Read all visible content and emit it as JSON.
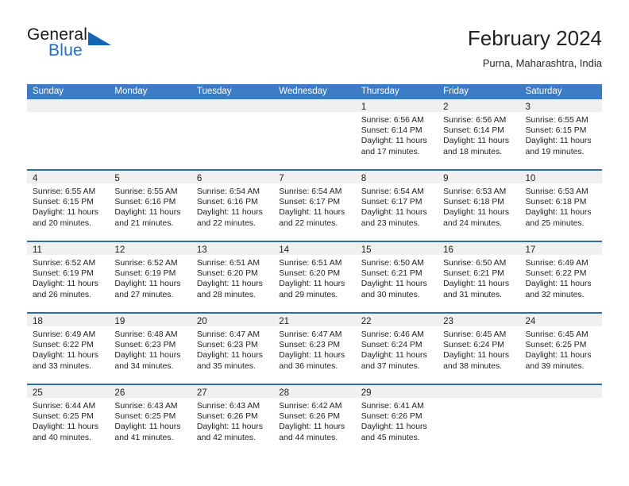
{
  "brand": {
    "name_top": "General",
    "name_bottom": "Blue",
    "accent_color": "#1166b4"
  },
  "header": {
    "title": "February 2024",
    "subtitle": "Purna, Maharashtra, India"
  },
  "theme": {
    "header_band": "#3b7cc4",
    "row_divider": "#2e6cad",
    "day_band": "#f0f0f0"
  },
  "weekdays": [
    "Sunday",
    "Monday",
    "Tuesday",
    "Wednesday",
    "Thursday",
    "Friday",
    "Saturday"
  ],
  "weeks": [
    [
      {
        "day": "",
        "sunrise": "",
        "sunset": "",
        "daylight1": "",
        "daylight2": ""
      },
      {
        "day": "",
        "sunrise": "",
        "sunset": "",
        "daylight1": "",
        "daylight2": ""
      },
      {
        "day": "",
        "sunrise": "",
        "sunset": "",
        "daylight1": "",
        "daylight2": ""
      },
      {
        "day": "",
        "sunrise": "",
        "sunset": "",
        "daylight1": "",
        "daylight2": ""
      },
      {
        "day": "1",
        "sunrise": "Sunrise: 6:56 AM",
        "sunset": "Sunset: 6:14 PM",
        "daylight1": "Daylight: 11 hours",
        "daylight2": "and 17 minutes."
      },
      {
        "day": "2",
        "sunrise": "Sunrise: 6:56 AM",
        "sunset": "Sunset: 6:14 PM",
        "daylight1": "Daylight: 11 hours",
        "daylight2": "and 18 minutes."
      },
      {
        "day": "3",
        "sunrise": "Sunrise: 6:55 AM",
        "sunset": "Sunset: 6:15 PM",
        "daylight1": "Daylight: 11 hours",
        "daylight2": "and 19 minutes."
      }
    ],
    [
      {
        "day": "4",
        "sunrise": "Sunrise: 6:55 AM",
        "sunset": "Sunset: 6:15 PM",
        "daylight1": "Daylight: 11 hours",
        "daylight2": "and 20 minutes."
      },
      {
        "day": "5",
        "sunrise": "Sunrise: 6:55 AM",
        "sunset": "Sunset: 6:16 PM",
        "daylight1": "Daylight: 11 hours",
        "daylight2": "and 21 minutes."
      },
      {
        "day": "6",
        "sunrise": "Sunrise: 6:54 AM",
        "sunset": "Sunset: 6:16 PM",
        "daylight1": "Daylight: 11 hours",
        "daylight2": "and 22 minutes."
      },
      {
        "day": "7",
        "sunrise": "Sunrise: 6:54 AM",
        "sunset": "Sunset: 6:17 PM",
        "daylight1": "Daylight: 11 hours",
        "daylight2": "and 22 minutes."
      },
      {
        "day": "8",
        "sunrise": "Sunrise: 6:54 AM",
        "sunset": "Sunset: 6:17 PM",
        "daylight1": "Daylight: 11 hours",
        "daylight2": "and 23 minutes."
      },
      {
        "day": "9",
        "sunrise": "Sunrise: 6:53 AM",
        "sunset": "Sunset: 6:18 PM",
        "daylight1": "Daylight: 11 hours",
        "daylight2": "and 24 minutes."
      },
      {
        "day": "10",
        "sunrise": "Sunrise: 6:53 AM",
        "sunset": "Sunset: 6:18 PM",
        "daylight1": "Daylight: 11 hours",
        "daylight2": "and 25 minutes."
      }
    ],
    [
      {
        "day": "11",
        "sunrise": "Sunrise: 6:52 AM",
        "sunset": "Sunset: 6:19 PM",
        "daylight1": "Daylight: 11 hours",
        "daylight2": "and 26 minutes."
      },
      {
        "day": "12",
        "sunrise": "Sunrise: 6:52 AM",
        "sunset": "Sunset: 6:19 PM",
        "daylight1": "Daylight: 11 hours",
        "daylight2": "and 27 minutes."
      },
      {
        "day": "13",
        "sunrise": "Sunrise: 6:51 AM",
        "sunset": "Sunset: 6:20 PM",
        "daylight1": "Daylight: 11 hours",
        "daylight2": "and 28 minutes."
      },
      {
        "day": "14",
        "sunrise": "Sunrise: 6:51 AM",
        "sunset": "Sunset: 6:20 PM",
        "daylight1": "Daylight: 11 hours",
        "daylight2": "and 29 minutes."
      },
      {
        "day": "15",
        "sunrise": "Sunrise: 6:50 AM",
        "sunset": "Sunset: 6:21 PM",
        "daylight1": "Daylight: 11 hours",
        "daylight2": "and 30 minutes."
      },
      {
        "day": "16",
        "sunrise": "Sunrise: 6:50 AM",
        "sunset": "Sunset: 6:21 PM",
        "daylight1": "Daylight: 11 hours",
        "daylight2": "and 31 minutes."
      },
      {
        "day": "17",
        "sunrise": "Sunrise: 6:49 AM",
        "sunset": "Sunset: 6:22 PM",
        "daylight1": "Daylight: 11 hours",
        "daylight2": "and 32 minutes."
      }
    ],
    [
      {
        "day": "18",
        "sunrise": "Sunrise: 6:49 AM",
        "sunset": "Sunset: 6:22 PM",
        "daylight1": "Daylight: 11 hours",
        "daylight2": "and 33 minutes."
      },
      {
        "day": "19",
        "sunrise": "Sunrise: 6:48 AM",
        "sunset": "Sunset: 6:23 PM",
        "daylight1": "Daylight: 11 hours",
        "daylight2": "and 34 minutes."
      },
      {
        "day": "20",
        "sunrise": "Sunrise: 6:47 AM",
        "sunset": "Sunset: 6:23 PM",
        "daylight1": "Daylight: 11 hours",
        "daylight2": "and 35 minutes."
      },
      {
        "day": "21",
        "sunrise": "Sunrise: 6:47 AM",
        "sunset": "Sunset: 6:23 PM",
        "daylight1": "Daylight: 11 hours",
        "daylight2": "and 36 minutes."
      },
      {
        "day": "22",
        "sunrise": "Sunrise: 6:46 AM",
        "sunset": "Sunset: 6:24 PM",
        "daylight1": "Daylight: 11 hours",
        "daylight2": "and 37 minutes."
      },
      {
        "day": "23",
        "sunrise": "Sunrise: 6:45 AM",
        "sunset": "Sunset: 6:24 PM",
        "daylight1": "Daylight: 11 hours",
        "daylight2": "and 38 minutes."
      },
      {
        "day": "24",
        "sunrise": "Sunrise: 6:45 AM",
        "sunset": "Sunset: 6:25 PM",
        "daylight1": "Daylight: 11 hours",
        "daylight2": "and 39 minutes."
      }
    ],
    [
      {
        "day": "25",
        "sunrise": "Sunrise: 6:44 AM",
        "sunset": "Sunset: 6:25 PM",
        "daylight1": "Daylight: 11 hours",
        "daylight2": "and 40 minutes."
      },
      {
        "day": "26",
        "sunrise": "Sunrise: 6:43 AM",
        "sunset": "Sunset: 6:25 PM",
        "daylight1": "Daylight: 11 hours",
        "daylight2": "and 41 minutes."
      },
      {
        "day": "27",
        "sunrise": "Sunrise: 6:43 AM",
        "sunset": "Sunset: 6:26 PM",
        "daylight1": "Daylight: 11 hours",
        "daylight2": "and 42 minutes."
      },
      {
        "day": "28",
        "sunrise": "Sunrise: 6:42 AM",
        "sunset": "Sunset: 6:26 PM",
        "daylight1": "Daylight: 11 hours",
        "daylight2": "and 44 minutes."
      },
      {
        "day": "29",
        "sunrise": "Sunrise: 6:41 AM",
        "sunset": "Sunset: 6:26 PM",
        "daylight1": "Daylight: 11 hours",
        "daylight2": "and 45 minutes."
      },
      {
        "day": "",
        "sunrise": "",
        "sunset": "",
        "daylight1": "",
        "daylight2": ""
      },
      {
        "day": "",
        "sunrise": "",
        "sunset": "",
        "daylight1": "",
        "daylight2": ""
      }
    ]
  ]
}
